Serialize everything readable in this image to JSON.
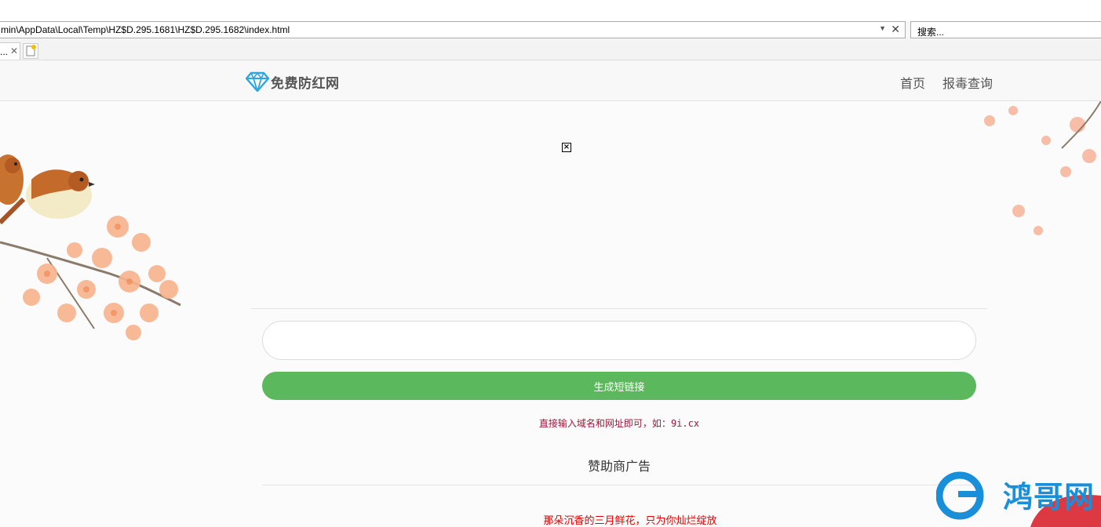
{
  "browser": {
    "address": "min\\AppData\\Local\\Temp\\HZ$D.295.1681\\HZ$D.295.1682\\index.html",
    "search_placeholder": "搜索...",
    "tab_title": "..."
  },
  "header": {
    "logo_text": "免费防红网",
    "nav": [
      {
        "label": "首页"
      },
      {
        "label": "报毒查询"
      }
    ]
  },
  "main": {
    "url_input_value": "",
    "generate_button": "生成短链接",
    "hint_prefix": "直接输入域名和网址即可，如：",
    "hint_example": "9i.cx",
    "sponsor_title": "赞助商广告",
    "ad_text": "那朵沉香的三月鲜花，只为你灿烂绽放"
  },
  "watermark": {
    "text": "鸿哥网"
  },
  "colors": {
    "brand_icon": "#2ea7e0",
    "button": "#5cb85c",
    "hint": "#a1173c",
    "ad": "#e00000"
  }
}
